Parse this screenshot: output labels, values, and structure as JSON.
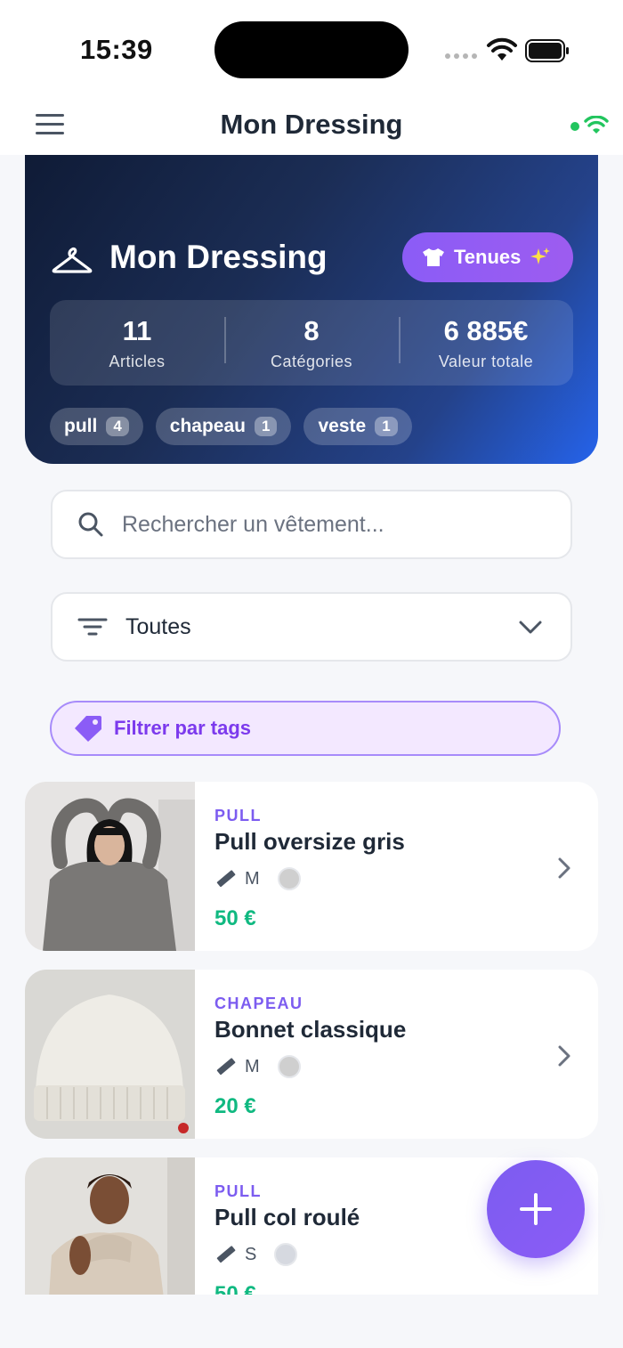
{
  "status_bar": {
    "time": "15:39"
  },
  "nav": {
    "title": "Mon Dressing"
  },
  "hero": {
    "title": "Mon Dressing",
    "outfits_label": "Tenues",
    "stats": [
      {
        "value": "11",
        "label": "Articles"
      },
      {
        "value": "8",
        "label": "Catégories"
      },
      {
        "value": "6 885€",
        "label": "Valeur totale"
      }
    ],
    "tags": [
      {
        "label": "pull",
        "count": "4"
      },
      {
        "label": "chapeau",
        "count": "1"
      },
      {
        "label": "veste",
        "count": "1"
      }
    ]
  },
  "search": {
    "placeholder": "Rechercher un vêtement..."
  },
  "category_filter": {
    "value": "Toutes"
  },
  "tag_filter": {
    "label": "Filtrer par tags"
  },
  "items": [
    {
      "category": "PULL",
      "name": "Pull oversize gris",
      "size": "M",
      "price": "50 €",
      "color": "#cfcfcf"
    },
    {
      "category": "CHAPEAU",
      "name": "Bonnet classique",
      "size": "M",
      "price": "20 €",
      "color": "#cfcfcf"
    },
    {
      "category": "PULL",
      "name": "Pull col roulé",
      "size": "S",
      "price": "50 €",
      "color": "#d6d9e0"
    }
  ],
  "colors": {
    "accent": "#7c5cf0",
    "price": "#10b981",
    "hero_start": "#0f1b36",
    "hero_end": "#2563eb"
  }
}
